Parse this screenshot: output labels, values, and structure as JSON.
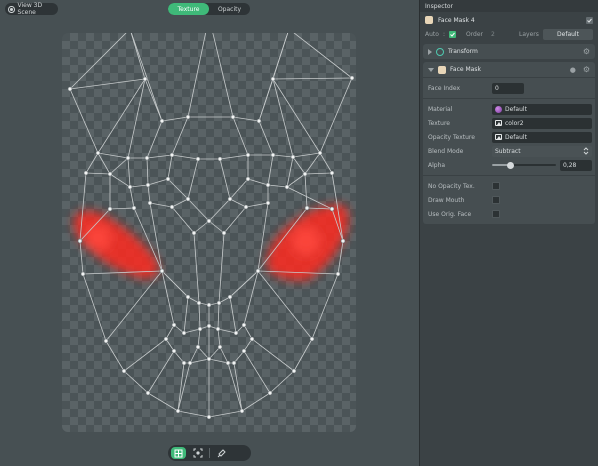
{
  "viewport": {
    "view_3d_label": "View 3D Scene",
    "tabs": [
      {
        "label": "Texture",
        "active": true
      },
      {
        "label": "Opacity",
        "active": false
      }
    ],
    "tools": [
      "mesh-tool-icon",
      "frame-select-icon",
      "pin-tool-icon"
    ],
    "accent_color": "#3fb979",
    "highlight_color": "#ff2a22"
  },
  "inspector": {
    "title": "Inspector",
    "object_name": "Face Mask 4",
    "enabled": true,
    "auto_label": "Auto",
    "auto_checked": true,
    "order_label": "Order",
    "order_value": "2",
    "layers_label": "Layers",
    "layers_value": "Default",
    "transform": {
      "label": "Transform",
      "expanded": false
    },
    "face_mask": {
      "label": "Face Mask",
      "expanded": true,
      "face_index_label": "Face Index",
      "face_index_value": "0",
      "material_label": "Material",
      "material_value": "Default",
      "texture_label": "Texture",
      "texture_value": "color2",
      "opacity_texture_label": "Opacity Texture",
      "opacity_texture_value": "Default",
      "blend_mode_label": "Blend Mode",
      "blend_mode_value": "Subtract",
      "alpha_label": "Alpha",
      "alpha_value": "0,28",
      "alpha_fraction": 0.28,
      "no_opacity_tex_label": "No Opacity Tex.",
      "no_opacity_tex_checked": false,
      "draw_mouth_label": "Draw Mouth",
      "draw_mouth_checked": false,
      "use_orig_face_label": "Use Orig. Face",
      "use_orig_face_checked": false
    }
  }
}
